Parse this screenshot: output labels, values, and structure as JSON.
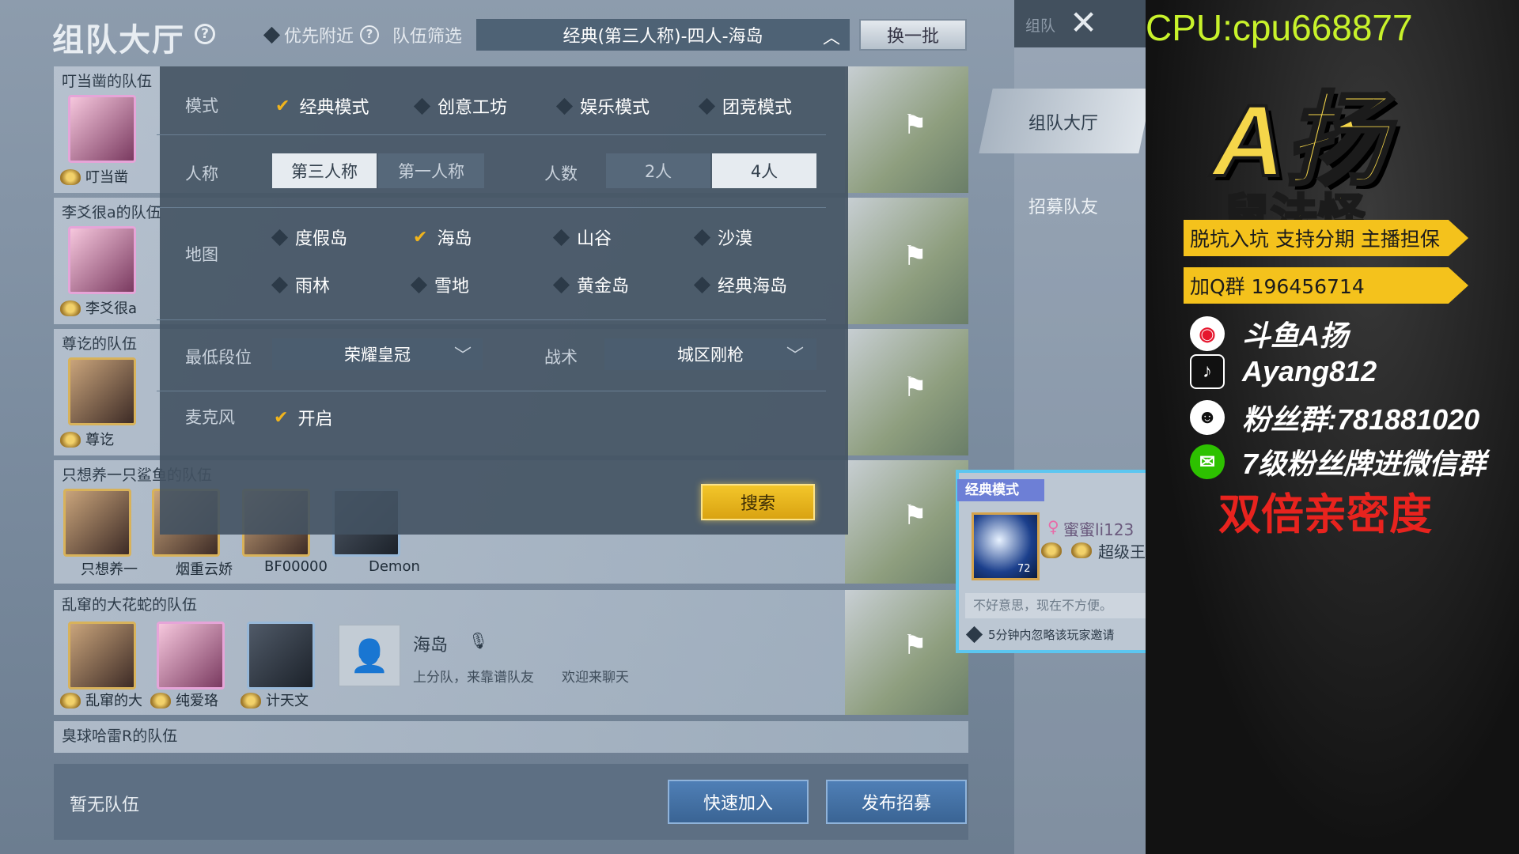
{
  "header": {
    "title": "组队大厅",
    "nearby_label": "优先附近",
    "filter_label": "队伍筛选",
    "filter_value": "经典(第三人称)-四人-海岛",
    "refresh_label": "换一批"
  },
  "teams": [
    {
      "name": "叮当凿的队伍",
      "players": [
        "叮当凿"
      ]
    },
    {
      "name": "李爻很a的队伍",
      "players": [
        "李爻很a"
      ]
    },
    {
      "name": "尊讫的队伍",
      "players": [
        "尊讫"
      ]
    },
    {
      "name": "只想养一只鲨鱼的队伍",
      "players": [
        "只想养一",
        "烟重云娇",
        "BF00000",
        "Demon"
      ]
    },
    {
      "name": "乱窜的大花蛇的队伍",
      "players": [
        "乱窜的大",
        "纯爱珞",
        "计天文"
      ],
      "map": "海岛",
      "note1": "上分队，来靠谱队友",
      "note2": "欢迎来聊天"
    },
    {
      "name": "臭球哈雷R的队伍",
      "players": []
    }
  ],
  "filter_panel": {
    "mode_label": "模式",
    "modes": [
      "经典模式",
      "创意工坊",
      "娱乐模式",
      "团竞模式"
    ],
    "perspective_label": "人称",
    "perspectives": [
      "第三人称",
      "第一人称"
    ],
    "count_label": "人数",
    "counts": [
      "2人",
      "4人"
    ],
    "map_label": "地图",
    "maps": [
      "度假岛",
      "海岛",
      "山谷",
      "沙漠",
      "雨林",
      "雪地",
      "黄金岛",
      "经典海岛"
    ],
    "min_rank_label": "最低段位",
    "min_rank_value": "荣耀皇冠",
    "tactic_label": "战术",
    "tactic_value": "城区刚枪",
    "mic_label": "麦克风",
    "mic_value": "开启",
    "search_label": "搜索"
  },
  "bottom": {
    "empty_label": "暂无队伍",
    "quick_join": "快速加入",
    "publish": "发布招募"
  },
  "sidebar": {
    "top_label": "组队",
    "tab_lobby": "组队大厅",
    "tab_recruit": "招募队友"
  },
  "invite": {
    "tag": "经典模式",
    "name": "蜜蜜li123",
    "rank": "超级王",
    "level": "72",
    "message": "不好意思，现在不方便。",
    "ignore": "5分钟内忽略该玩家邀请"
  },
  "stream": {
    "cpu": "CPU:cpu668877",
    "logo": "A扬",
    "logo_sub": "鼠法怪",
    "ribbon1": "脱坑入坑 支持分期 主播担保",
    "ribbon2": "加Q群 196456714",
    "weibo": "斗鱼A扬",
    "tiktok": "Ayang812",
    "qq": "粉丝群:781881020",
    "wechat": "7级粉丝牌进微信群",
    "promo": "双倍亲密度"
  },
  "colors": {
    "accent_gold": "#f0b41c",
    "search_button": "#f3c62a",
    "promo_red": "#e8231e",
    "cpu_green": "#c8f22b"
  }
}
